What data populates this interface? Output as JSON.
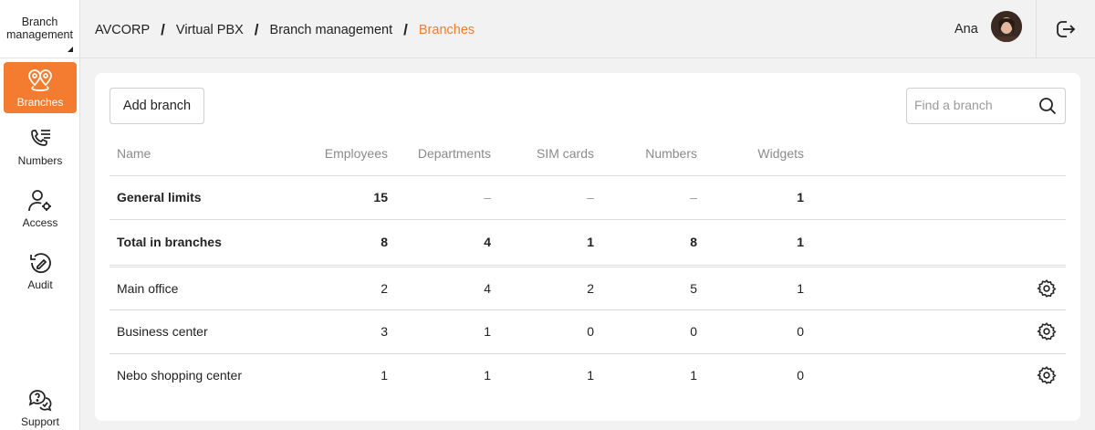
{
  "app_switcher": {
    "label_line1": "Branch",
    "label_line2": "management"
  },
  "sidebar": {
    "items": [
      {
        "label": "Branches",
        "icon": "branches-pin-icon",
        "active": true
      },
      {
        "label": "Numbers",
        "icon": "phone-list-icon",
        "active": false
      },
      {
        "label": "Access",
        "icon": "user-gear-icon",
        "active": false
      },
      {
        "label": "Audit",
        "icon": "audit-icon",
        "active": false
      },
      {
        "label": "Support",
        "icon": "support-chat-icon",
        "active": false
      }
    ]
  },
  "breadcrumb": [
    "AVCORP",
    "Virtual PBX",
    "Branch management",
    "Branches"
  ],
  "header": {
    "user_name": "Ana"
  },
  "toolbar": {
    "add_label": "Add branch",
    "search_placeholder": "Find a branch"
  },
  "table": {
    "headers": [
      "Name",
      "Employees",
      "Departments",
      "SIM cards",
      "Numbers",
      "Widgets"
    ],
    "summary_rows": [
      {
        "name": "General limits",
        "employees": "15",
        "departments": "–",
        "sim": "–",
        "numbers": "–",
        "widgets": "1"
      },
      {
        "name": "Total in branches",
        "employees": "8",
        "departments": "4",
        "sim": "1",
        "numbers": "8",
        "widgets": "1"
      }
    ],
    "rows": [
      {
        "name": "Main office",
        "employees": "2",
        "departments": "4",
        "sim": "2",
        "numbers": "5",
        "widgets": "1"
      },
      {
        "name": "Business center",
        "employees": "3",
        "departments": "1",
        "sim": "0",
        "numbers": "0",
        "widgets": "0"
      },
      {
        "name": "Nebo shopping center",
        "employees": "1",
        "departments": "1",
        "sim": "1",
        "numbers": "1",
        "widgets": "0"
      }
    ]
  },
  "colors": {
    "accent": "#f47c30",
    "background": "#f2f2f2",
    "card": "#ffffff"
  }
}
